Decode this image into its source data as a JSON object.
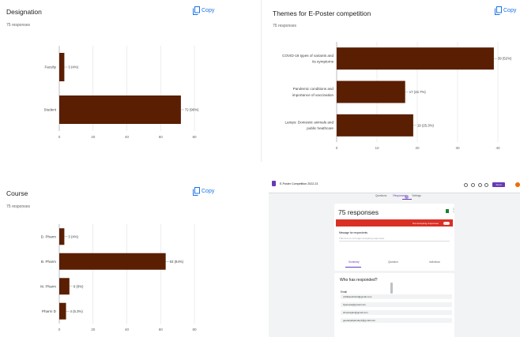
{
  "copy_label": "Copy",
  "panels": [
    {
      "title": "Designation",
      "subtitle": "75 responses"
    },
    {
      "title": "Themes for E-Poster competition",
      "subtitle": "75 responses"
    },
    {
      "title": "Course",
      "subtitle": "75 responses"
    }
  ],
  "chart_data": [
    {
      "type": "bar",
      "orientation": "horizontal",
      "title": "Designation",
      "categories": [
        "Faculty",
        "Student"
      ],
      "values": [
        3,
        72
      ],
      "labels": [
        "3 (4%)",
        "72 (96%)"
      ],
      "xlim": [
        0,
        80
      ],
      "xticks": [
        0,
        20,
        40,
        60,
        80
      ],
      "color": "#5a1e02",
      "grid": true
    },
    {
      "type": "bar",
      "orientation": "horizontal",
      "title": "Themes for E-Poster competition",
      "categories": [
        [
          "COVID-19 types of variants and",
          "its symptoms"
        ],
        [
          "Pandemic conditions and",
          "importance of vaccination"
        ],
        [
          "Lamps: Domestic animals and",
          "public heathcare"
        ]
      ],
      "values": [
        39,
        17,
        19
      ],
      "labels": [
        "39 (52%)",
        "17 (22.7%)",
        "19 (25.3%)"
      ],
      "xlim": [
        0,
        40
      ],
      "xticks": [
        0,
        10,
        20,
        30,
        40
      ],
      "color": "#5a1e02",
      "grid": true
    },
    {
      "type": "bar",
      "orientation": "horizontal",
      "title": "Course",
      "categories": [
        "D. Pharm",
        "B. Pharm",
        "M. Pharm",
        "Pharm D"
      ],
      "values": [
        3,
        63,
        6,
        4
      ],
      "labels": [
        "3 (4%)",
        "63 (84%)",
        "6 (8%)",
        "4 (5.3%)"
      ],
      "xlim": [
        0,
        80
      ],
      "xticks": [
        0,
        20,
        40,
        60,
        80
      ],
      "color": "#5a1e02",
      "grid": true
    }
  ],
  "form_screenshot": {
    "form_title": "E-Poster Competition 2022-23",
    "send_label": "Send",
    "tabs": [
      "Questions",
      "Responses",
      "Settings"
    ],
    "responses_heading": "75 responses",
    "accepting_label": "Not accepting responses",
    "message_label": "Message for respondents",
    "message_placeholder": "This form is no longer accepting responses",
    "subtabs": [
      "Summary",
      "Question",
      "Individual"
    ],
    "question": "Who has responded?",
    "email_label": "Email",
    "emails": [
      "vidhikaushik14@gmail.com",
      "fiyaneeta@gmail.com",
      "shivansjain@gmail.com",
      "geetanjalipandey2@gmail.com"
    ],
    "colors": {
      "accent": "#673ab7",
      "closed_bar": "#d93025",
      "sheets": "#188038"
    }
  }
}
